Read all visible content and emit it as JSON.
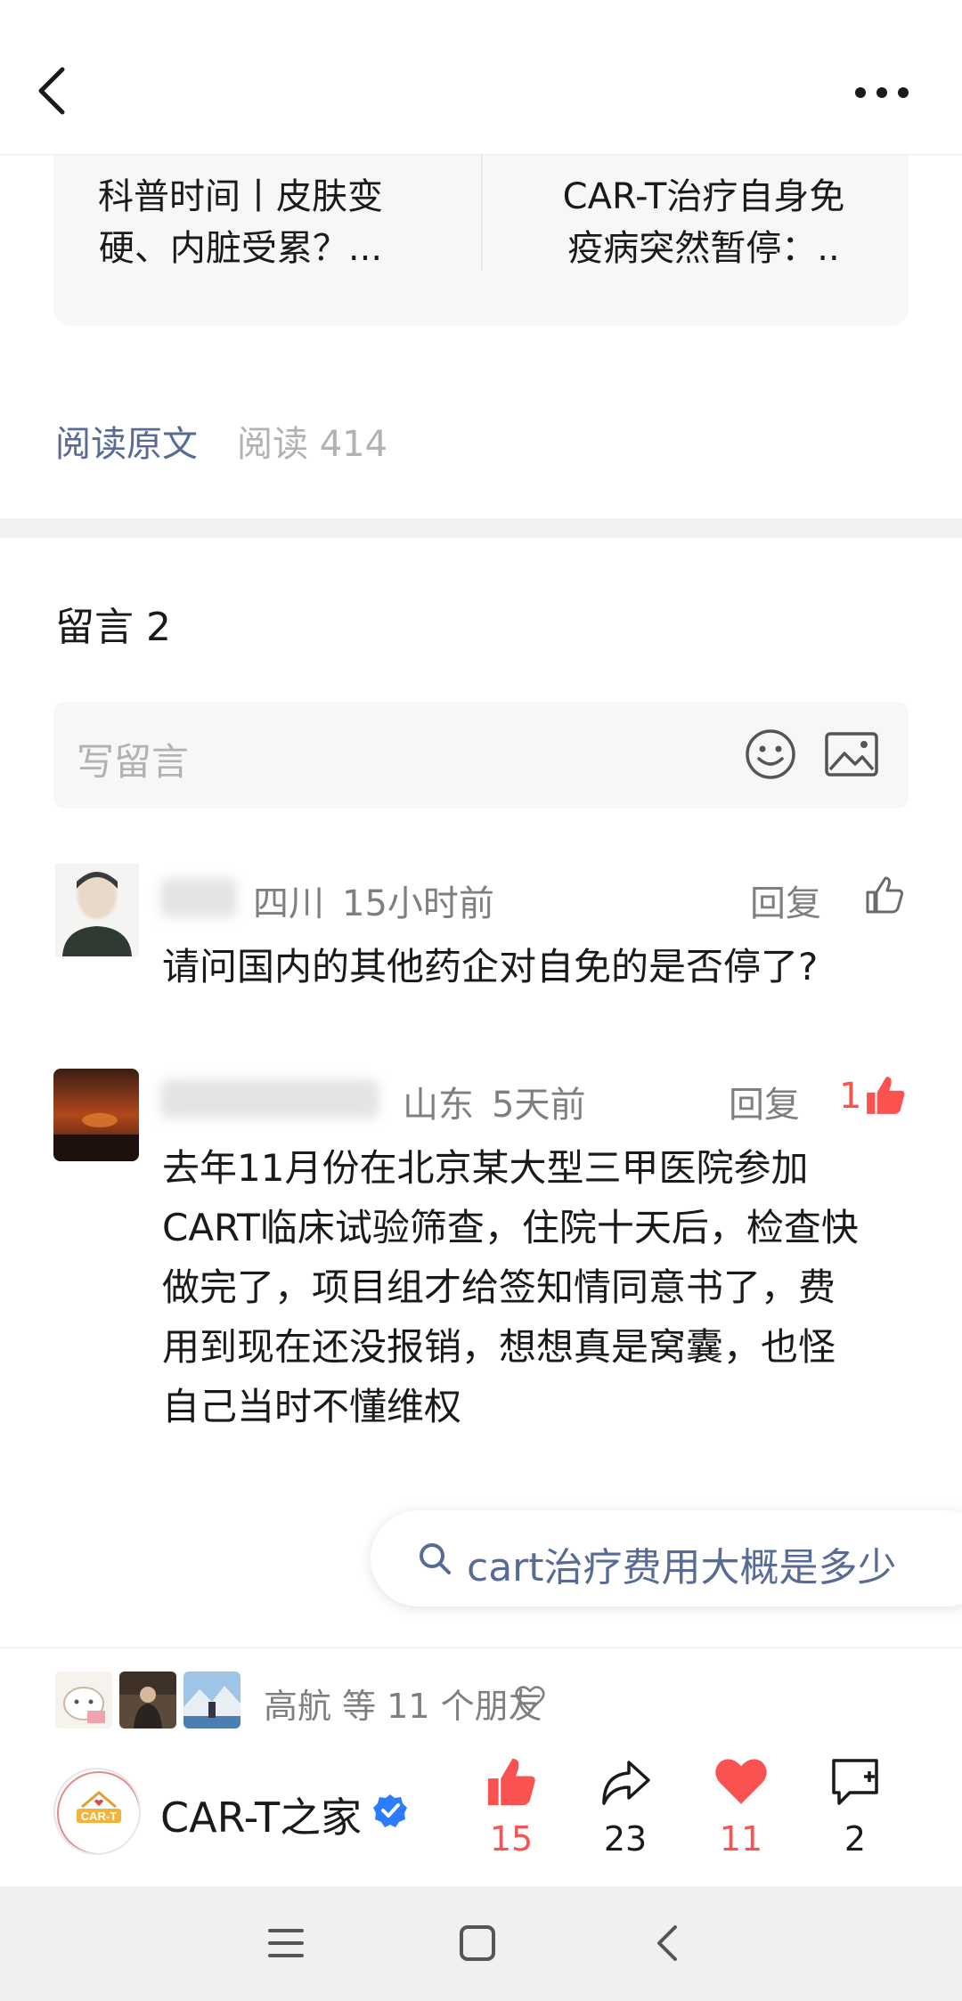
{
  "related_articles": [
    {
      "title_line1": "科普时间丨皮肤变",
      "title_line2": "硬、内脏受累？..."
    },
    {
      "title_line1": "CAR-T治疗自身免",
      "title_line2": "疫病突然暂停：.."
    }
  ],
  "read_original": "阅读原文",
  "read_count": "阅读 414",
  "comments": {
    "title": "留言 2",
    "input_placeholder": "写留言",
    "items": [
      {
        "location": "四川",
        "time": "15小时前",
        "reply_label": "回复",
        "likes": "",
        "text_lines": [
          "请问国内的其他药企对自免的是否停了?"
        ]
      },
      {
        "location": "山东",
        "time": "5天前",
        "reply_label": "回复",
        "likes": "1",
        "text_lines": [
          "去年11月份在北京某大型三甲医院参加",
          "CART临床试验筛查，住院十天后，检查快",
          "做完了，项目组才给签知情同意书了，费",
          "用到现在还没报销，想想真是窝囊，也怪",
          "自己当时不懂维权"
        ]
      }
    ]
  },
  "search_suggestion": "cart治疗费用大概是多少",
  "friends": {
    "text": "高航 等 11 个朋友"
  },
  "account": {
    "name": "CAR-T之家",
    "logo_text": "CAR-T"
  },
  "actions": {
    "like": "15",
    "share": "23",
    "favorite": "11",
    "comment": "2"
  },
  "colors": {
    "link": "#576b95",
    "accent_red": "#fa5151",
    "verified_blue": "#2b7cff"
  }
}
